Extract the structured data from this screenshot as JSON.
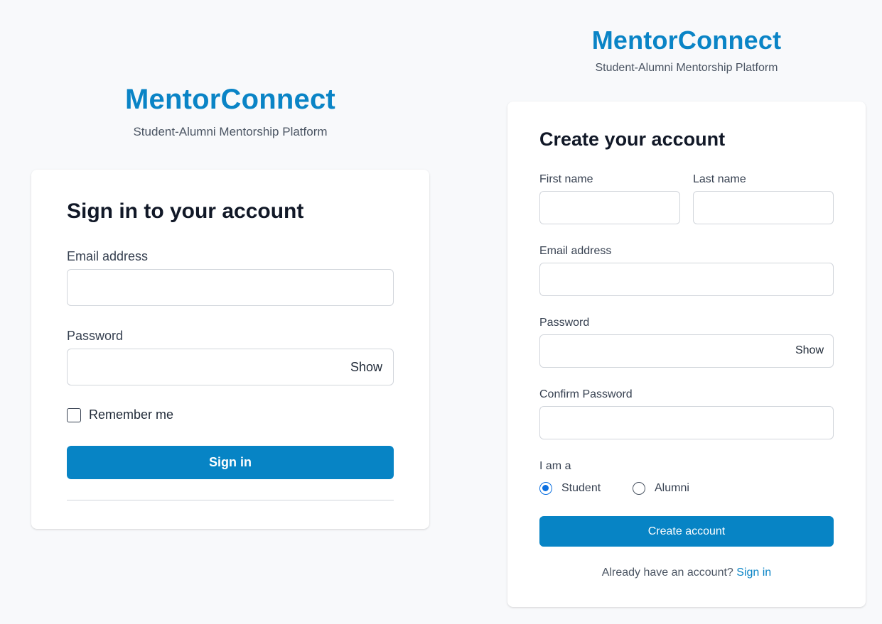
{
  "brand": {
    "name": "MentorConnect",
    "tagline": "Student-Alumni Mentorship Platform",
    "accent_color": "#0784c5"
  },
  "signin": {
    "heading": "Sign in to your account",
    "email_label": "Email address",
    "email_value": "",
    "password_label": "Password",
    "password_value": "",
    "show_label": "Show",
    "remember_label": "Remember me",
    "remember_checked": false,
    "submit_label": "Sign in"
  },
  "signup": {
    "heading": "Create your account",
    "first_name_label": "First name",
    "last_name_label": "Last name",
    "email_label": "Email address",
    "password_label": "Password",
    "show_label": "Show",
    "confirm_password_label": "Confirm Password",
    "role_label": "I am a",
    "role_options": [
      "Student",
      "Alumni"
    ],
    "role_selected": "Student",
    "submit_label": "Create account",
    "footer_text": "Already have an account?",
    "footer_link": "Sign in"
  }
}
